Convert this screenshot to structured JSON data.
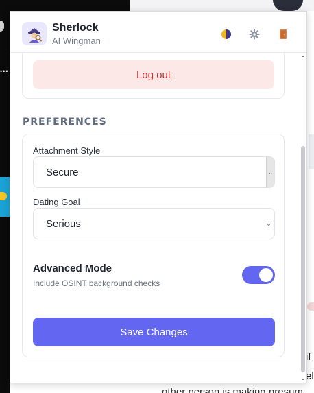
{
  "app": {
    "name": "Sherlock",
    "tagline": "AI Wingman"
  },
  "header_icons": [
    "theme-toggle-icon",
    "gear-icon",
    "door-icon"
  ],
  "account": {
    "logout_label": "Log out"
  },
  "preferences": {
    "section_title": "PREFERENCES",
    "attachment_style": {
      "label": "Attachment Style",
      "value": "Secure"
    },
    "dating_goal": {
      "label": "Dating Goal",
      "value": "Serious"
    },
    "advanced_mode": {
      "title": "Advanced Mode",
      "description": "Include OSINT background checks",
      "enabled": true
    },
    "save_label": "Save Changes"
  },
  "colors": {
    "accent": "#6366f1",
    "danger_bg": "#fde8e8",
    "danger_text": "#c53030"
  },
  "background_page": {
    "text_fragment_1": "if",
    "text_fragment_2": "el",
    "text_fragment_3": "other person is making presum"
  }
}
